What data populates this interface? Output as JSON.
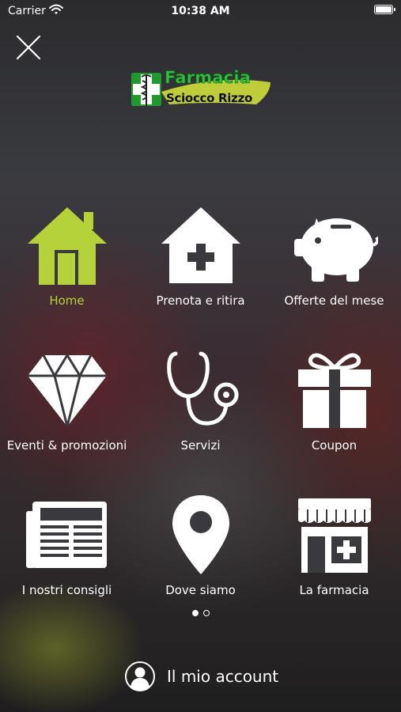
{
  "status_bar": {
    "carrier": "Carrier",
    "time": "10:38 AM",
    "icons": [
      "wifi-icon",
      "battery-icon"
    ]
  },
  "header": {
    "close_icon": "close-icon",
    "logo": {
      "line1": "Farmacia",
      "line2": "Sciocco Rizzo",
      "colors": {
        "green": "#2fbf3f",
        "yellow_swoosh": "#c7d63a"
      }
    }
  },
  "menu": {
    "page": 1,
    "pages_total": 2,
    "items": [
      {
        "label": "Home",
        "icon": "home-icon",
        "active": true
      },
      {
        "label": "Prenota e ritira",
        "icon": "pharmacy-house-icon",
        "active": false
      },
      {
        "label": "Offerte del mese",
        "icon": "piggy-bank-icon",
        "active": false
      },
      {
        "label": "Eventi & promozioni",
        "icon": "diamond-icon",
        "active": false
      },
      {
        "label": "Servizi",
        "icon": "stethoscope-icon",
        "active": false
      },
      {
        "label": "Coupon",
        "icon": "gift-icon",
        "active": false
      },
      {
        "label": "I nostri consigli",
        "icon": "newspaper-icon",
        "active": false
      },
      {
        "label": "Dove siamo",
        "icon": "map-pin-icon",
        "active": false
      },
      {
        "label": "La farmacia",
        "icon": "storefront-icon",
        "active": false
      }
    ]
  },
  "footer": {
    "account_label": "Il mio account",
    "account_icon": "user-icon"
  },
  "colors": {
    "active": "#b5d23a",
    "text": "#ffffff"
  }
}
